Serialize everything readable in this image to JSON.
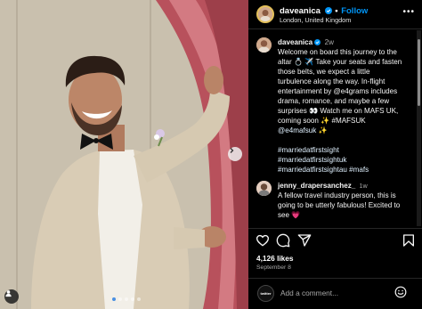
{
  "post": {
    "username": "daveanica",
    "follow_label": "Follow",
    "separator": "•",
    "location": "London, United Kingdom",
    "more_label": "•••"
  },
  "caption": {
    "username": "daveanica",
    "time": "2w",
    "lines": [
      "Welcome on board this journey to the",
      "altar 💍 ✈️ Take your seats and fasten",
      "those belts, we expect a little",
      "turbulence along the way. In-flight",
      "entertainment by @e4grams includes",
      "drama, romance, and maybe a few",
      "surprises 👀 Watch me on MAFS UK,",
      "coming soon ✨ #MAFSUK",
      "@e4mafsuk ✨"
    ],
    "hashtags": [
      "#marriedatfirstsight",
      "#marriedatfirstsightuk",
      "#marriedatfirstsightau #mafs"
    ]
  },
  "comment": {
    "username": "jenny_drapersanchez_",
    "time": "1w",
    "text": "A fellow travel industry person, this is going to be utterly fabulous! Excited to see 💗"
  },
  "stats": {
    "likes": "4,126 likes",
    "date": "September 8"
  },
  "composer": {
    "placeholder": "Add a comment...",
    "avatar_label": "twitter"
  },
  "colors": {
    "link": "#e0f1ff",
    "follow": "#0095f6",
    "verified": "#0095f6",
    "curtain": "#c4606a"
  },
  "carousel": {
    "slides": 5,
    "active_index": 0
  }
}
